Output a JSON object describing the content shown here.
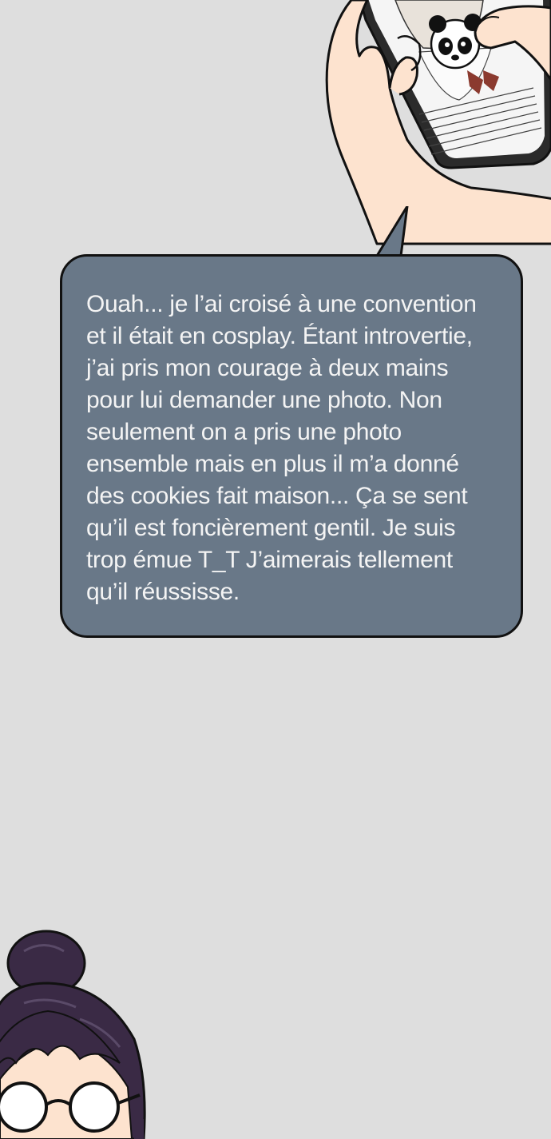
{
  "speech_bubble": {
    "text": "Ouah... je l’ai croisé à une convention\net il était en cosplay. Étant introvertie,\nj’ai pris mon courage à deux mains\npour lui demander une photo. Non\nseulement on a pris une photo\nensemble mais en plus il m’a donné\ndes cookies fait maison... Ça se sent\nqu’il est foncièrement gentil. Je suis\ntrop émue T_T J’aimerais tellement\nqu’il réussisse."
  },
  "phone_screen_text": "pris une photo avec lui en pensant que c'était future célébrité, comme il est beau, mais j'ai ouvert que c'était Gyo-Bin Sung, l'auteur de novel. En cherchant son nom, j'ai réalisé était super connu et avait écrit de nombreuses",
  "colors": {
    "background": "#dedede",
    "bubble_fill": "#697888",
    "bubble_text": "#f4f4f4",
    "outline": "#111111",
    "skin": "#fde3cf",
    "hair": "#3a2a45"
  }
}
